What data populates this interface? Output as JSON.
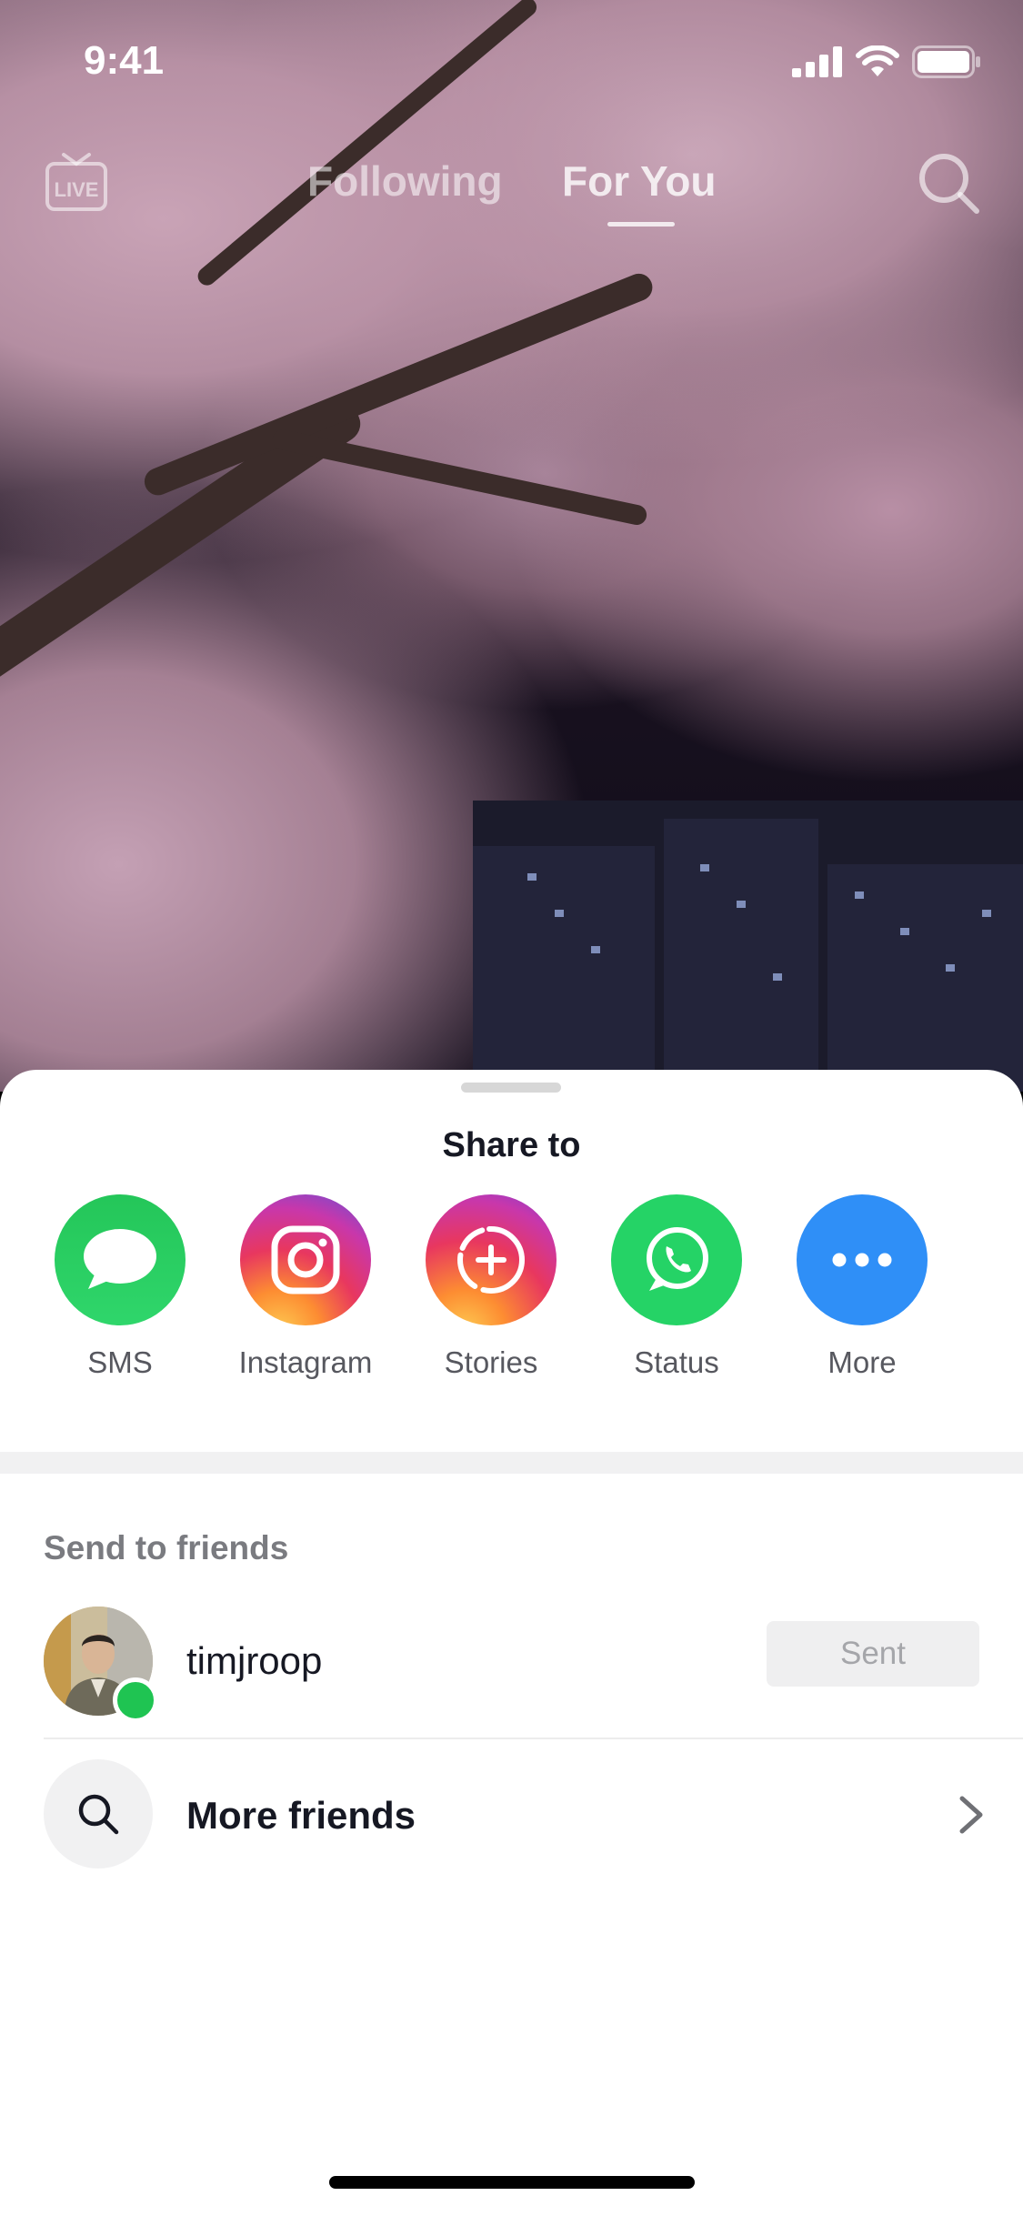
{
  "status_bar": {
    "time": "9:41"
  },
  "top_nav": {
    "live_label": "LIVE",
    "tabs": [
      {
        "label": "Following"
      },
      {
        "label": "For You"
      }
    ],
    "active_tab": "For You"
  },
  "share_sheet": {
    "title": "Share to",
    "targets": [
      {
        "label": "SMS",
        "icon": "message-bubble-icon",
        "color": "#25c45b"
      },
      {
        "label": "Instagram",
        "icon": "instagram-icon",
        "color": "#d6249f"
      },
      {
        "label": "Stories",
        "icon": "stories-add-icon",
        "color": "#e84a5f"
      },
      {
        "label": "Status",
        "icon": "whatsapp-icon",
        "color": "#25d366"
      },
      {
        "label": "More",
        "icon": "more-dots-icon",
        "color": "#2f8ff7"
      }
    ],
    "friends_section_title": "Send to friends",
    "friends": [
      {
        "username": "timjroop",
        "status": "online",
        "action_label": "Sent"
      }
    ],
    "more_friends_label": "More friends"
  },
  "colors": {
    "online": "#1fc452",
    "text_primary": "#161823",
    "text_secondary": "#7a7b80"
  }
}
